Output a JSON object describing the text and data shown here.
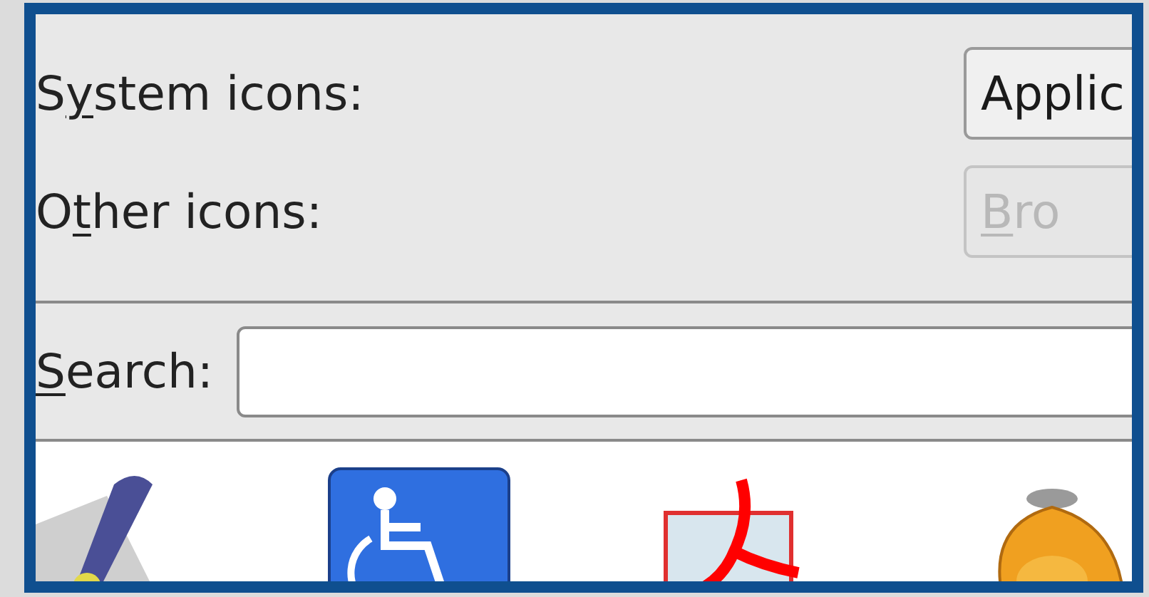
{
  "rows": [
    {
      "label": [
        {
          "text": "S",
          "underline": false
        },
        {
          "text": "y",
          "underline": true
        },
        {
          "text": "stem icons:",
          "underline": false
        }
      ],
      "button": {
        "label": [
          {
            "text": "Applic",
            "underline": false
          }
        ],
        "disabled": false
      }
    },
    {
      "label": [
        {
          "text": "O",
          "underline": false
        },
        {
          "text": "t",
          "underline": true
        },
        {
          "text": "her icons:",
          "underline": false
        }
      ],
      "button": {
        "label": [
          {
            "text": "B",
            "underline": true
          },
          {
            "text": "ro",
            "underline": false
          }
        ],
        "disabled": true
      }
    }
  ],
  "search": {
    "label": [
      {
        "text": "S",
        "underline": true
      },
      {
        "text": "earch:",
        "underline": false
      }
    ]
  },
  "icons": [
    {
      "kind": "pen"
    },
    {
      "kind": "wheelchair"
    },
    {
      "kind": "pdf"
    },
    {
      "kind": "mascot"
    }
  ]
}
